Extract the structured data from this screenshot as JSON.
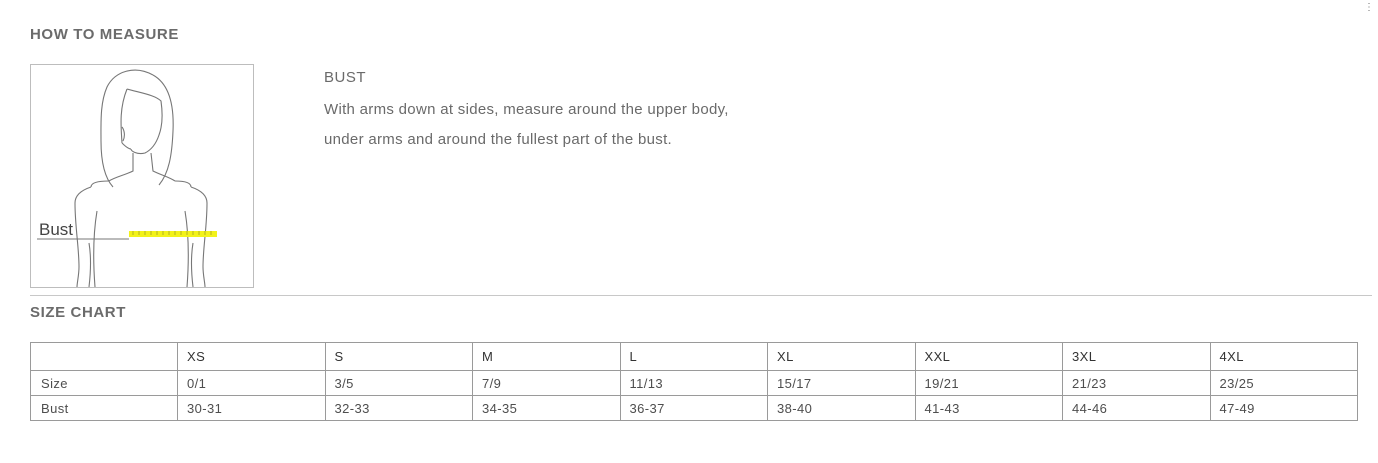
{
  "how_to_measure": {
    "title": "HOW TO MEASURE",
    "figure_label": "Bust",
    "figure_accent_color": "#f2f21a",
    "heading": "BUST",
    "description": "With arms down at sides, measure around the upper body, under arms and around the fullest part of the bust."
  },
  "size_chart": {
    "title": "SIZE CHART",
    "sizes": [
      "XS",
      "S",
      "M",
      "L",
      "XL",
      "XXL",
      "3XL",
      "4XL"
    ],
    "rows": [
      {
        "label": "Size",
        "values": [
          "0/1",
          "3/5",
          "7/9",
          "11/13",
          "15/17",
          "19/21",
          "21/23",
          "23/25"
        ]
      },
      {
        "label": "Bust",
        "values": [
          "30-31",
          "32-33",
          "34-35",
          "36-37",
          "38-40",
          "41-43",
          "44-46",
          "47-49"
        ]
      }
    ]
  },
  "corner_mark": "⋮"
}
